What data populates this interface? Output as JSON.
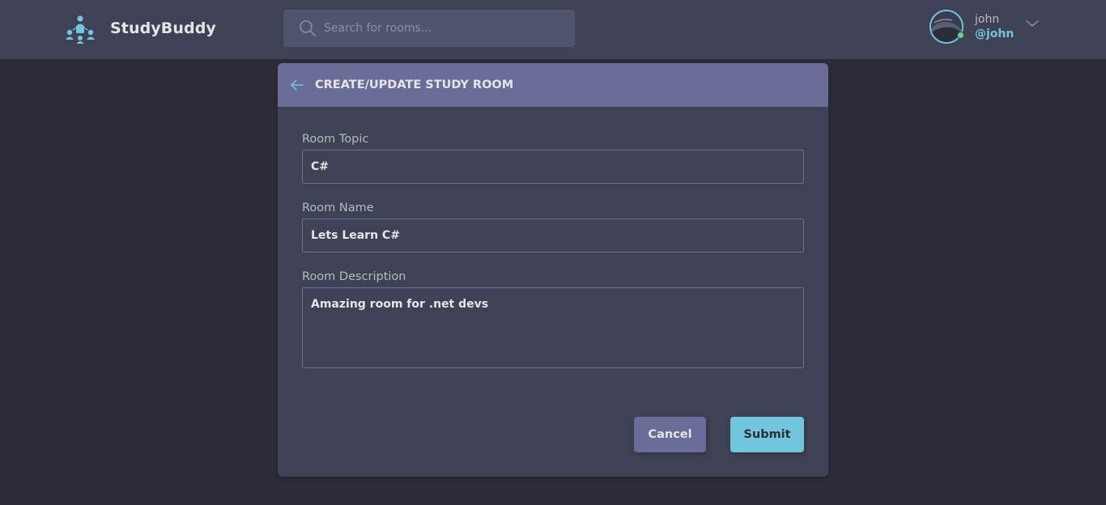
{
  "colors": {
    "background": "#2d2d39",
    "header": "#3f4156",
    "accent": "#71c6dd",
    "card_header": "#696d97",
    "online": "#5dd693"
  },
  "header": {
    "logo_icon": "study-group-icon",
    "brand": "StudyBuddy",
    "search": {
      "icon": "search-icon",
      "placeholder": "Search for rooms..."
    },
    "profile": {
      "name": "john",
      "handle": "@john",
      "status": "online",
      "menu_icon": "chevron-down-icon"
    }
  },
  "form_card": {
    "back_icon": "arrow-left-icon",
    "title": "CREATE/UPDATE STUDY ROOM",
    "fields": {
      "topic": {
        "label": "Room Topic",
        "value": "C#"
      },
      "name": {
        "label": "Room Name",
        "value": "Lets Learn C#"
      },
      "description": {
        "label": "Room Description",
        "value": "Amazing room for .net devs"
      }
    },
    "actions": {
      "cancel": "Cancel",
      "submit": "Submit"
    }
  }
}
